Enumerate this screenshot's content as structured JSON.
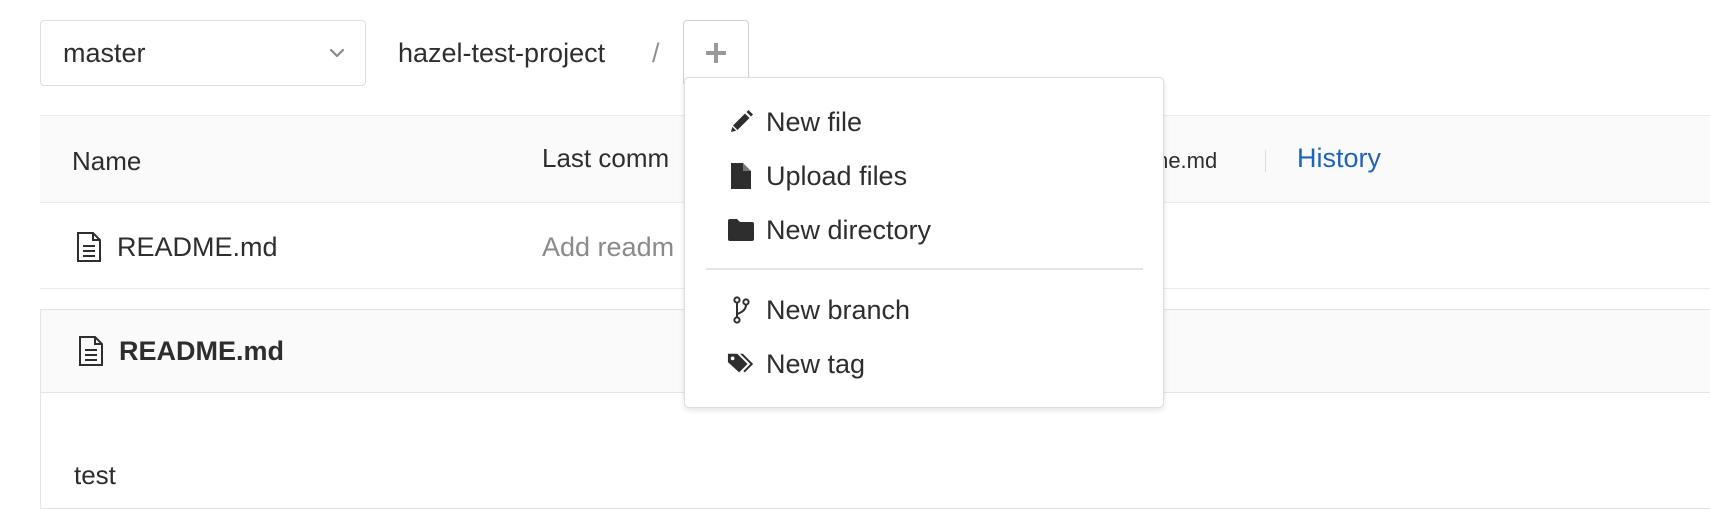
{
  "branch_selector": {
    "value": "master"
  },
  "breadcrumb": {
    "project": "hazel-test-project",
    "separator": "/"
  },
  "add_button": {
    "icon": "plus-icon"
  },
  "table": {
    "headers": {
      "name": "Name",
      "last_commit": "Last comm",
      "last_commit_file": "me.md",
      "history": "History"
    },
    "rows": [
      {
        "name": "README.md",
        "commit": "Add readm",
        "icon": "file-text-icon"
      }
    ]
  },
  "readme": {
    "title": "README.md",
    "content": "test"
  },
  "dropdown": {
    "items": [
      {
        "label": "New file",
        "icon": "pencil-icon"
      },
      {
        "label": "Upload files",
        "icon": "file-icon"
      },
      {
        "label": "New directory",
        "icon": "folder-icon"
      },
      {
        "label": "New branch",
        "icon": "branch-icon"
      },
      {
        "label": "New tag",
        "icon": "tag-icon"
      }
    ]
  },
  "colors": {
    "link": "#1f63b8",
    "text": "#2e2e2e",
    "muted": "#8a8a8a",
    "header_bg": "#fafafa",
    "border": "#e5e5e5"
  }
}
